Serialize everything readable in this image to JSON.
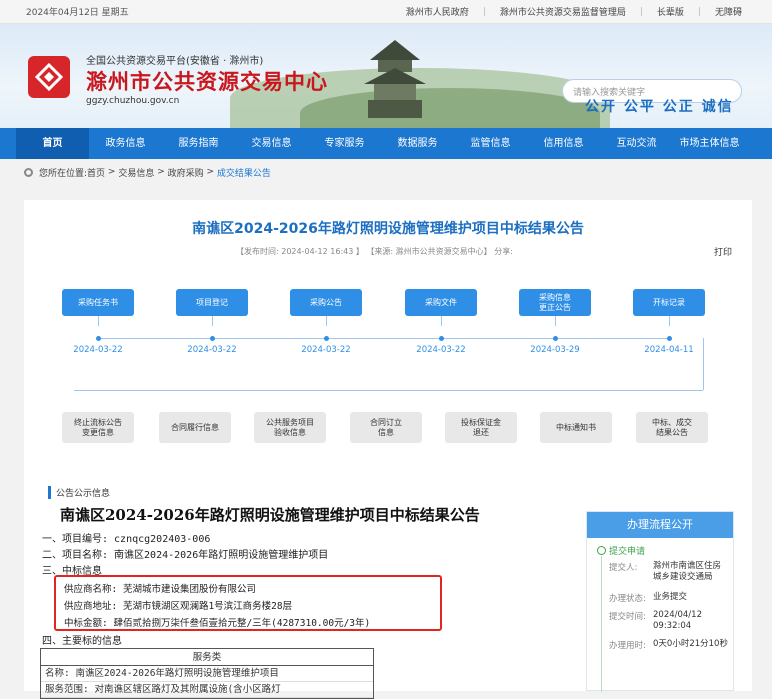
{
  "topbar": {
    "date": "2024年04月12日 星期五",
    "links": [
      "滁州市人民政府",
      "滁州市公共资源交易监督管理局",
      "长辈版",
      "无障碍"
    ]
  },
  "header": {
    "subtitle": "全国公共资源交易平台(安徽省 · 滁州市)",
    "title": "滁州市公共资源交易中心",
    "url": "ggzy.chuzhou.gov.cn",
    "search_placeholder": "请输入搜索关键字",
    "slogan": "公开 公平 公正 诚信",
    "brand_color": "#c9171e"
  },
  "nav": {
    "items": [
      "首页",
      "政务信息",
      "服务指南",
      "交易信息",
      "专家服务",
      "数据服务",
      "监管信息",
      "信用信息",
      "互动交流",
      "市场主体信息"
    ],
    "active_index": 0,
    "color": "#1c77d0"
  },
  "breadcrumb": {
    "prefix": "您所在位置:",
    "path": [
      "首页",
      "交易信息",
      "政府采购",
      "成交结果公告"
    ]
  },
  "article": {
    "title": "南谯区2024-2026年路灯照明设施管理维护项目中标结果公告",
    "meta": "【发布时间: 2024-04-12 16:43 】  【来源: 滁州市公共资源交易中心】 分享:",
    "print": "打印"
  },
  "process": {
    "top_steps": [
      {
        "label": "采购任务书",
        "date": "2024-03-22"
      },
      {
        "label": "项目登记",
        "date": "2024-03-22"
      },
      {
        "label": "采购公告",
        "date": "2024-03-22"
      },
      {
        "label": "采购文件",
        "date": "2024-03-22"
      },
      {
        "label": "采购信息\n更正公告",
        "date": "2024-03-29"
      },
      {
        "label": "开标记录",
        "date": "2024-04-11"
      }
    ],
    "bottom_steps": [
      "终止流标公告\n变更信息",
      "合同履行信息",
      "公共服务项目\n验收信息",
      "合同订立\n信息",
      "投标保证金\n退还",
      "中标通知书",
      "中标、成交\n结果公告"
    ]
  },
  "announcement": {
    "section_label": "公告公示信息",
    "title": "南谯区2024-2026年路灯照明设施管理维护项目中标结果公告",
    "lines": {
      "project_no": "一、项目编号: cznqcg202403-006",
      "project_name": "二、项目名称: 南谯区2024-2026年路灯照明设施管理维护项目",
      "bid_info": "三、中标信息",
      "supplier_name": "供应商名称: 芜湖城市建设集团股份有限公司",
      "supplier_addr": "供应商地址: 芜湖市镜湖区观澜路1号滨江商务楼28层",
      "amount": "中标金额: 肆佰贰拾捌万柒仟叁佰壹拾元整/三年(4287310.00元/3年)",
      "main_info": "四、主要标的信息"
    },
    "table": {
      "header": "服务类",
      "rows": [
        "名称: 南谯区2024-2026年路灯照明设施管理维护项目",
        "服务范围: 对南谯区辖区路灯及其附属设施(含小区路灯"
      ]
    }
  },
  "side": {
    "title": "办理流程公开",
    "step": "提交申请",
    "fields": [
      {
        "label": "提交人:",
        "value": "滁州市南谯区住房城乡建设交通局"
      },
      {
        "label": "办理状态:",
        "value": "业务提交"
      },
      {
        "label": "提交时间:",
        "value": "2024/04/12 09:32:04"
      },
      {
        "label": "办理用时:",
        "value": "0天0小时21分10秒"
      }
    ]
  }
}
